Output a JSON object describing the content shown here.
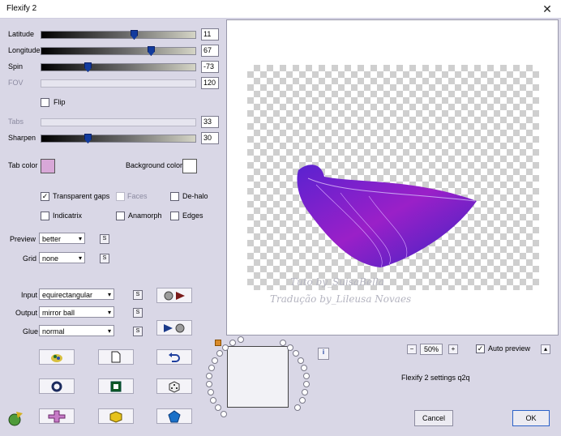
{
  "window": {
    "title": "Flexify 2",
    "close_glyph": "✕"
  },
  "sliders": [
    {
      "label": "Latitude",
      "value": "11",
      "fraction": 0.6,
      "disabled": false
    },
    {
      "label": "Longitude",
      "value": "67",
      "fraction": 0.71,
      "disabled": false
    },
    {
      "label": "Spin",
      "value": "-73",
      "fraction": 0.3,
      "disabled": false
    },
    {
      "label": "FOV",
      "value": "120",
      "fraction": null,
      "disabled": true
    },
    {
      "label": "Tabs",
      "value": "33",
      "fraction": null,
      "disabled": true
    },
    {
      "label": "Sharpen",
      "value": "30",
      "fraction": 0.3,
      "disabled": false
    }
  ],
  "flip": {
    "label": "Flip",
    "checked": false
  },
  "colors": {
    "tab_color_label": "Tab color",
    "tab_color": "#d8a8d8",
    "background_color_label": "Background color",
    "background_color": "#ffffff",
    "accent": "#2c62c8",
    "thumb": "#123b9e"
  },
  "options": {
    "transparent_gaps": {
      "label": "Transparent gaps",
      "checked": true
    },
    "faces": {
      "label": "Faces",
      "checked": false,
      "disabled": true
    },
    "de_halo": {
      "label": "De-halo",
      "checked": false
    },
    "indicatrix": {
      "label": "Indicatrix",
      "checked": false
    },
    "anamorph": {
      "label": "Anamorph",
      "checked": false
    },
    "edges": {
      "label": "Edges",
      "checked": false
    }
  },
  "preview_quality": {
    "label": "Preview",
    "value": "better"
  },
  "grid": {
    "label": "Grid",
    "value": "none"
  },
  "input": {
    "label": "Input",
    "value": "equirectangular"
  },
  "output": {
    "label": "Output",
    "value": "mirror ball"
  },
  "glue": {
    "label": "Glue",
    "value": "normal"
  },
  "small_btn_glyph": "S",
  "zoom": {
    "value": "50%",
    "minus": "−",
    "plus": "+"
  },
  "auto_preview": {
    "label": "Auto preview",
    "checked": true
  },
  "settings_name": "Flexify 2 settings q2q",
  "info_glyph": "i",
  "buttons": {
    "cancel": "Cancel",
    "ok": "OK"
  },
  "watermark": {
    "line1": "Tuto by_SuisaBella",
    "line2": "Tradução by_Lileusa Novaes"
  },
  "icons": [
    "eye-glasses-arrow-icon",
    "ball-arrow-icon",
    "palette-icon",
    "document-icon",
    "undo-icon",
    "ring-icon",
    "square-frame-icon",
    "dice-icon",
    "plus-shape-icon",
    "box-icon",
    "pentagon-icon",
    "earth-pen-icon"
  ]
}
